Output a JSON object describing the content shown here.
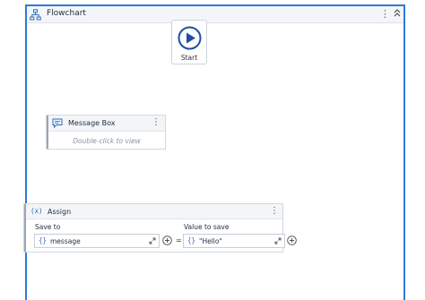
{
  "header": {
    "title": "Flowchart",
    "menu_glyph": "⋮",
    "collapse_icon": "chevrons-up-icon"
  },
  "start": {
    "label": "Start",
    "icon": "play-circle-icon"
  },
  "message_box": {
    "name": "Message Box",
    "hint": "Double-click to view",
    "menu_glyph": "⋮",
    "icon": "message-icon"
  },
  "assign": {
    "icon_text": "(x)",
    "name": "Assign",
    "menu_glyph": "⋮",
    "save_to_label": "Save to",
    "value_label": "Value to save",
    "save_to_brace": "{}",
    "save_to_value": "message",
    "equals": "=",
    "value_brace": "{}",
    "value_value": "\"Hello\""
  },
  "colors": {
    "accent": "#2d7bd6",
    "icon_blue": "#2d6bc4",
    "connector": "#a9b0b8"
  }
}
